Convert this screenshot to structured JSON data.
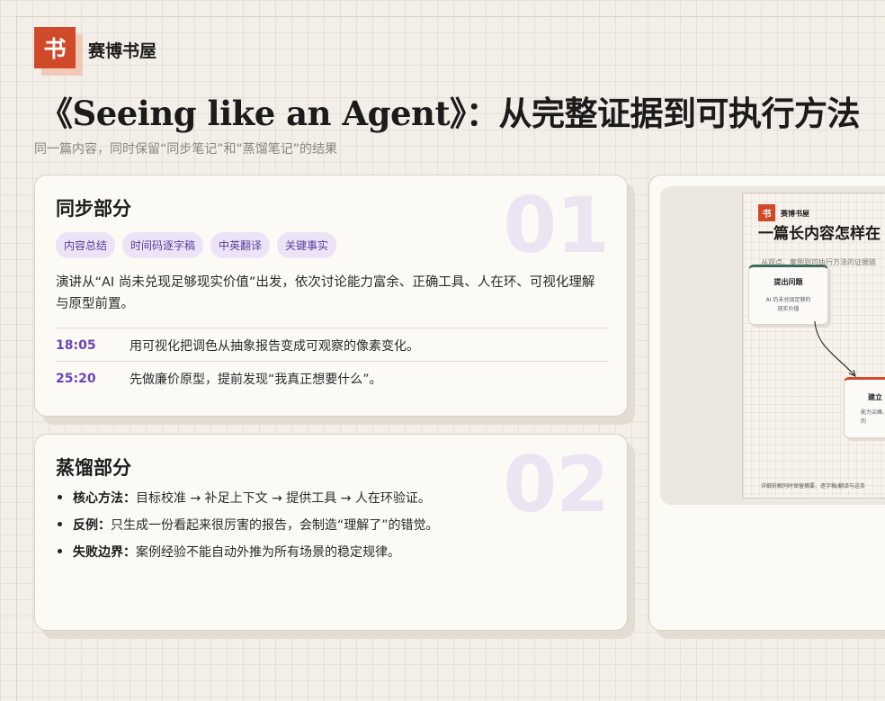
{
  "brand": {
    "logo_char": "书",
    "name": "赛博书屋"
  },
  "header": {
    "title": "《Seeing like an Agent》：从完整证据到可执行方法",
    "subtitle": "同一篇内容，同时保留“同步笔记”和“蒸馏笔记”的结果"
  },
  "sync_card": {
    "title": "同步部分",
    "number": "01",
    "tags": [
      "内容总结",
      "时间码逐字稿",
      "中英翻译",
      "关键事实"
    ],
    "summary": "演讲从“AI 尚未兑现足够现实价值”出发，依次讨论能力富余、正确工具、人在环、可视化理解与原型前置。",
    "timestamps": [
      {
        "time": "18:05",
        "text": "用可视化把调色从抽象报告变成可观察的像素变化。"
      },
      {
        "time": "25:20",
        "text": "先做廉价原型，提前发现“我真正想要什么”。"
      }
    ]
  },
  "distill_card": {
    "title": "蒸馏部分",
    "number": "02",
    "points": [
      {
        "key": "核心方法：",
        "text": "目标校准 → 补足上下文 → 提供工具 → 人在环验证。"
      },
      {
        "key": "反例：",
        "text": "只生成一份看起来很厉害的报告，会制造“理解了”的错觉。"
      },
      {
        "key": "失败边界：",
        "text": "案例经验不能自动外推为所有场景的稳定规律。"
      }
    ]
  },
  "preview_card": {
    "logo_char": "书",
    "brand": "赛博书屋",
    "title": "一篇长内容怎样在",
    "subtitle": "从观点、案例到可执行方法的证据链",
    "node1": {
      "title": "提出问题",
      "body_lines": [
        "AI 仍未兑现足够的",
        "现实价值"
      ]
    },
    "node2": {
      "title": "建立",
      "body_lines": [
        "能力尖峰、",
        "的"
      ]
    },
    "footer": "详细拆解同时保留摘要、逐字稿/翻译与这条"
  }
}
